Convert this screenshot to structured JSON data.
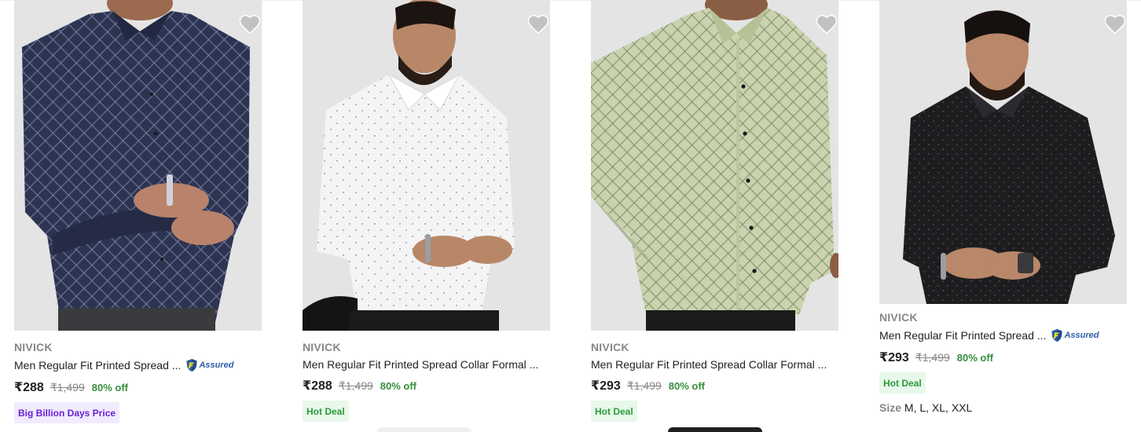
{
  "products": [
    {
      "brand": "NIVICK",
      "title": "Men Regular Fit Printed Spread ...",
      "assured": "Assured",
      "price": "₹288",
      "mrp": "₹1,499",
      "discount": "80% off",
      "badge": "Big Billion Days Price",
      "shirt_color": "#2d3452",
      "pattern_color": "#8d97b8"
    },
    {
      "brand": "NIVICK",
      "title": "Men Regular Fit Printed Spread Collar Formal ...",
      "price": "₹288",
      "mrp": "₹1,499",
      "discount": "80% off",
      "badge": "Hot Deal",
      "shirt_color": "#f4f4f4",
      "pattern_color": "#9aa1b3"
    },
    {
      "brand": "NIVICK",
      "title": "Men Regular Fit Printed Spread Collar Formal ...",
      "price": "₹293",
      "mrp": "₹1,499",
      "discount": "80% off",
      "badge": "Hot Deal",
      "shirt_color": "#c9d3ad",
      "pattern_color": "#6e7757"
    },
    {
      "brand": "NIVICK",
      "title": "Men Regular Fit Printed Spread ...",
      "assured": "Assured",
      "price": "₹293",
      "mrp": "₹1,499",
      "discount": "80% off",
      "badge": "Hot Deal",
      "size_label": "Size",
      "sizes": "M, L, XL, XXL",
      "shirt_color": "#1d1d1f",
      "pattern_color": "#55565c"
    }
  ],
  "icons": {
    "wishlist": "heart-icon",
    "assured": "flipkart-assured-icon"
  },
  "colors": {
    "price_green": "#388e3c",
    "muted": "#878787",
    "bbd_purple": "#6a1fd6",
    "hot_green": "#2b9b3d",
    "assured_blue": "#2b5fa8"
  }
}
